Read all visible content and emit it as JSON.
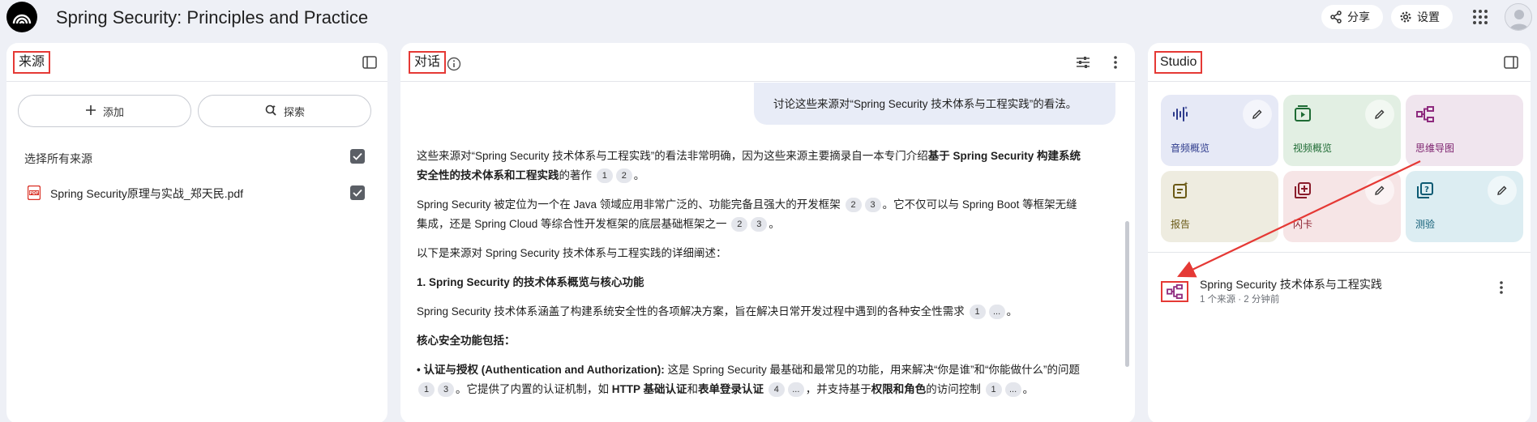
{
  "header": {
    "title": "Spring Security: Principles and Practice",
    "share_label": "分享",
    "settings_label": "设置",
    "icons": {
      "logo": "notebook-logo",
      "share": "share-icon",
      "settings": "gear-icon",
      "apps": "apps-grid-icon",
      "avatar": "user-avatar"
    }
  },
  "sources": {
    "title": "来源",
    "add_label": "添加",
    "explore_label": "探索",
    "select_all_label": "选择所有来源",
    "select_all_checked": true,
    "items": [
      {
        "name": "Spring Security原理与实战_郑天民.pdf",
        "icon": "pdf-icon",
        "checked": true
      }
    ]
  },
  "chat": {
    "title": "对话",
    "user_message": "讨论这些来源对“Spring Security 技术体系与工程实践”的看法。",
    "p1_a": "这些来源对“Spring Security 技术体系与工程实践”的看法非常明确，因为这些来源主要摘录自一本专门介绍",
    "p1_b": "基于 Spring Security 构建系统安全性的技术体系和工程实践",
    "p1_c": "的著作",
    "p2_a": "Spring Security 被定位为一个在 Java 领域应用非常广泛的、功能完备且强大的开发框架",
    "p2_b": "。它不仅可以与 Spring Boot 等框架无缝集成，还是 Spring Cloud 等综合性开发框架的底层基础框架之一",
    "p3": "以下是来源对 Spring Security 技术体系与工程实践的详细阐述：",
    "h1": "1. Spring Security 的技术体系概览与核心功能",
    "p4": "Spring Security 技术体系涵盖了构建系统安全性的各项解决方案，旨在解决日常开发过程中遇到的各种安全性需求",
    "h2": "核心安全功能包括：",
    "b1_a": "• 认证与授权 (Authentication and Authorization):",
    "b1_b": " 这是 Spring Security 最基础和最常见的功能，用来解决“你是谁”和“你能做什么”的问题",
    "b1_c": "。它提供了内置的认证机制，如 ",
    "b1_d": "HTTP 基础认证",
    "b1_e": "和",
    "b1_f": "表单登录认证",
    "b1_g": "，并支持基于",
    "b1_h": "权限和角色",
    "b1_i": "的访问控制",
    "cite": {
      "c1": "1",
      "c2": "2",
      "c3": "3",
      "c4": "4",
      "more": "..."
    },
    "period": "。"
  },
  "studio": {
    "title": "Studio",
    "tiles": [
      {
        "label": "音频概览",
        "icon": "audio-waveform-icon"
      },
      {
        "label": "视频概览",
        "icon": "video-play-icon"
      },
      {
        "label": "思维导图",
        "icon": "mindmap-icon"
      },
      {
        "label": "报告",
        "icon": "report-icon"
      },
      {
        "label": "闪卡",
        "icon": "flashcards-icon"
      },
      {
        "label": "测验",
        "icon": "quiz-icon"
      }
    ],
    "note": {
      "title": "Spring Security 技术体系与工程实践",
      "meta": "1 个来源 · 2 分钟前",
      "icon": "mindmap-icon"
    }
  },
  "colors": {
    "background": "#eef0f6",
    "panel": "#ffffff",
    "annotation_red": "#e53935",
    "mindmap_purple": "#8e2a7e"
  }
}
